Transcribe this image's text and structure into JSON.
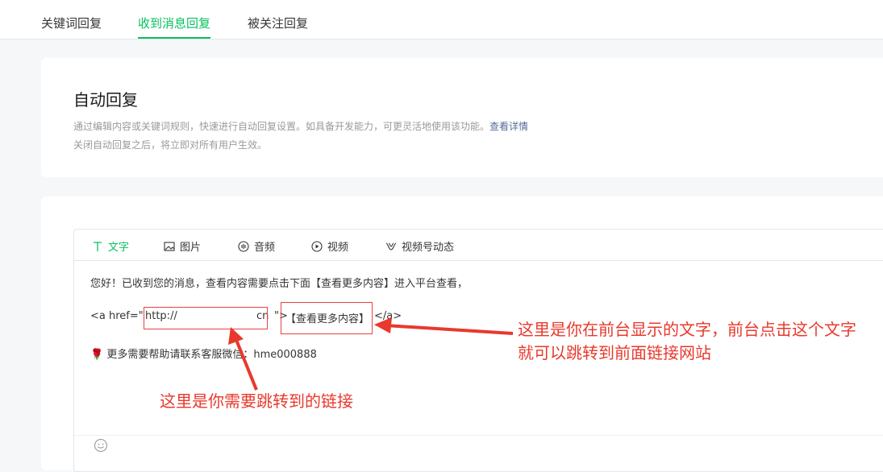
{
  "tabs": [
    {
      "label": "关键词回复",
      "active": false
    },
    {
      "label": "收到消息回复",
      "active": true
    },
    {
      "label": "被关注回复",
      "active": false
    }
  ],
  "info": {
    "title": "自动回复",
    "desc_line1": "通过编辑内容或关键词规则，快速进行自动回复设置。如具备开发能力，可更灵活地使用该功能。",
    "detail_link": "查看详情",
    "desc_line2": "关闭自动回复之后，将立即对所有用户生效。"
  },
  "editor": {
    "types": [
      {
        "label": "文字",
        "icon": "text-icon",
        "active": true
      },
      {
        "label": "图片",
        "icon": "image-icon",
        "active": false
      },
      {
        "label": "音频",
        "icon": "audio-icon",
        "active": false
      },
      {
        "label": "视频",
        "icon": "video-icon",
        "active": false
      },
      {
        "label": "视频号动态",
        "icon": "channels-icon",
        "active": false
      }
    ],
    "line1": "您好！已收到您的消息，查看内容需要点击下面【查看更多内容】进入平台查看，",
    "code_open": "<a href=\"",
    "code_url": "http://",
    "code_url_end": "cn",
    "code_close": "\">",
    "link_text": "【查看更多内容】",
    "code_end": "</a>",
    "line3": "更多需要帮助请联系客服微信：hme000888"
  },
  "annotations": {
    "right_line1": "这里是你在前台显示的文字，前台点击这个文字",
    "right_line2": "就可以跳转到前面链接网站",
    "bottom": "这里是你需要跳转到的链接"
  },
  "colors": {
    "accent": "#07c160",
    "annotation": "#e8392c",
    "link": "#576b95"
  }
}
